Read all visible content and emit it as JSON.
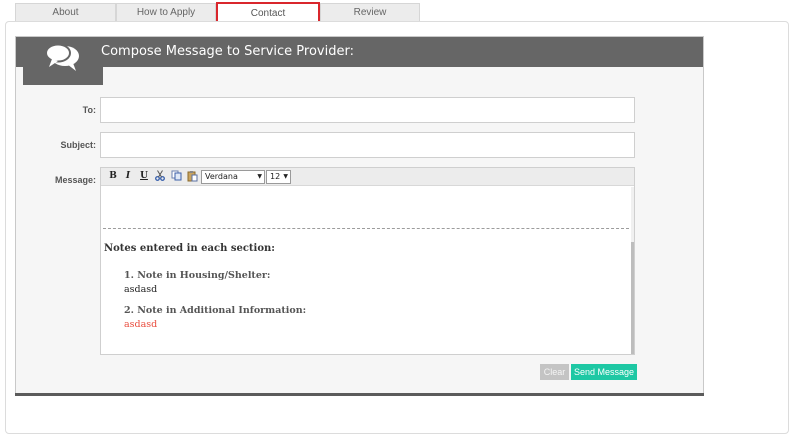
{
  "tabs": [
    {
      "label": "About",
      "active": false
    },
    {
      "label": "How to Apply",
      "active": false
    },
    {
      "label": "Contact",
      "active": true
    },
    {
      "label": "Review",
      "active": false
    }
  ],
  "compose": {
    "title": "Compose Message to Service Provider:",
    "icon": "speech-bubbles-icon",
    "to_label": "To:",
    "to_value": "",
    "subject_label": "Subject:",
    "subject_value": "",
    "message_label": "Message:"
  },
  "editor": {
    "toolbar": {
      "bold": "B",
      "italic": "I",
      "underline": "U",
      "font": "Verdana",
      "size": "12"
    },
    "notes_heading": "Notes entered in each section:",
    "notes": [
      {
        "title": "1. Note in Housing/Shelter:",
        "body": "asdasd",
        "color": "#222222"
      },
      {
        "title": "2. Note in Additional Information:",
        "body": "asdasd",
        "color": "#e94b3c"
      }
    ]
  },
  "buttons": {
    "clear": "Clear",
    "send": "Send Message"
  },
  "colors": {
    "active_tab_border": "#d9262c",
    "header_bg": "#666666",
    "send_button": "#1ec8a4",
    "clear_button": "#c4c4c4"
  }
}
